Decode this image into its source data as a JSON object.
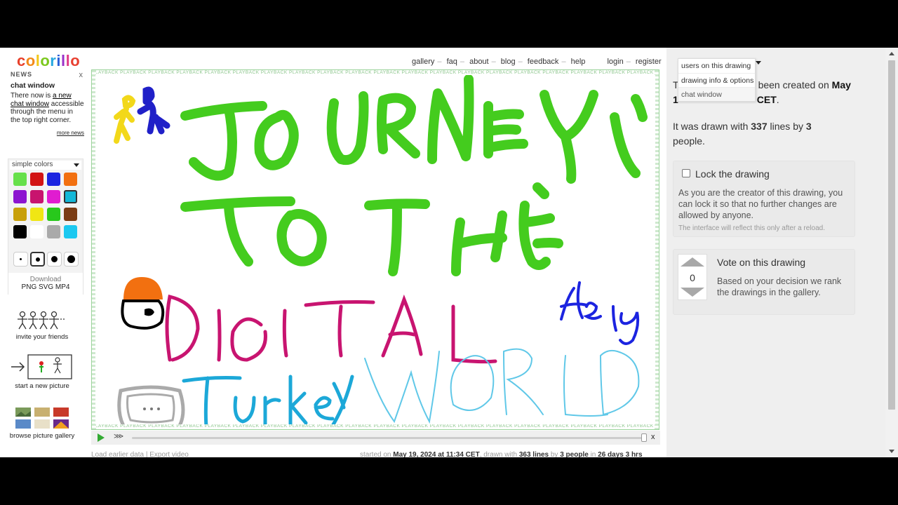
{
  "logo": "colorillo",
  "news": {
    "header": "NEWS",
    "close": "x",
    "title": "chat window",
    "body_pre": "There now is ",
    "body_link": "a new chat window",
    "body_post": " accessible through the menu in the top right corner.",
    "more": "more news"
  },
  "palette": {
    "selector_label": "simple colors",
    "swatches": [
      "#66e04a",
      "#d21414",
      "#1c24e0",
      "#f27010",
      "#8c14d0",
      "#c8146e",
      "#e01cd0",
      "#14b8d8",
      "#c8a00a",
      "#f0e614",
      "#28c81c",
      "#7a3c14",
      "#000000",
      "#ffffff",
      "#aaaaaa",
      "#1cc8f0"
    ],
    "download_label": "Download",
    "download_formats": "PNG SVG MP4"
  },
  "side_links": {
    "invite": "invite your friends",
    "new_picture": "start a new picture",
    "gallery": "browse picture gallery"
  },
  "nav": {
    "gallery": "gallery",
    "faq": "faq",
    "about": "about",
    "blog": "blog",
    "feedback": "feedback",
    "help": "help",
    "login": "login",
    "register": "register",
    "sep": "–"
  },
  "canvas": {
    "band_text": "PLAYBACK",
    "drawing_words": {
      "journey": "JOURNEY",
      "tothe": "TO THE",
      "digital": "DIGITAL",
      "turkey": "Turkey",
      "world": "WORLD",
      "signature": "Hely"
    }
  },
  "player": {
    "speed_icon": "⋙",
    "close": "x"
  },
  "bottom": {
    "load_earlier": "Load earlier data",
    "divider": "|",
    "export": "Export video",
    "started_pre": "started on ",
    "started_date": "May 19, 2024 at 11:34 CET",
    "drawn_pre": ", drawn with ",
    "drawn_lines": "363 lines",
    "by_pre": " by ",
    "by_people": "3 people",
    "in_pre": " in ",
    "duration": "26 days 3 hrs"
  },
  "info": {
    "created_pre": "T",
    "created_mid": "been created on ",
    "created_month": "May",
    "created_line2_pre": "1",
    "created_line2_tz": "CET",
    "drawn_pre": "It was drawn with ",
    "drawn_lines": "337",
    "drawn_mid": " lines by ",
    "drawn_people": "3",
    "drawn_post": " people."
  },
  "lock": {
    "label": "Lock the drawing",
    "desc": "As you are the creator of this drawing, you can lock it so that no further changes are allowed by anyone.",
    "note": "The interface will reflect this only after a reload."
  },
  "vote": {
    "count": "0",
    "title": "Vote on this drawing",
    "desc": "Based on your decision we rank the drawings in the gallery."
  },
  "dropdown": {
    "items": [
      "users on this drawing",
      "drawing info & options",
      "chat window"
    ]
  },
  "colors": {
    "logo": [
      "#e8402a",
      "#f28a1a",
      "#f2c81a",
      "#7cc81e",
      "#28a8e0",
      "#2a60d8",
      "#9a30c8",
      "#e03a8a",
      "#e84030"
    ],
    "green_band": "#8bc58b"
  }
}
